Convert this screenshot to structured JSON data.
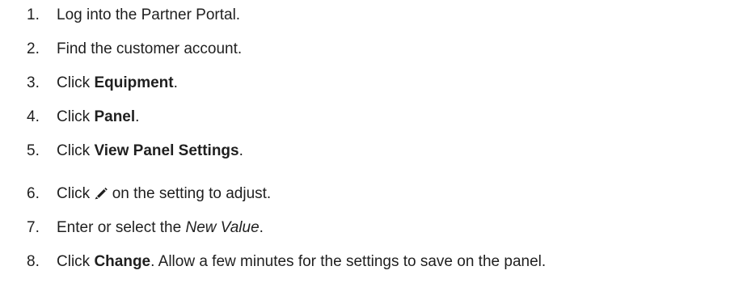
{
  "steps": [
    {
      "number": "1.",
      "text": "Log into the Partner Portal."
    },
    {
      "number": "2.",
      "text": "Find the customer account."
    },
    {
      "number": "3.",
      "pre": "Click ",
      "bold": "Equipment",
      "post": "."
    },
    {
      "number": "4.",
      "pre": "Click ",
      "bold": "Panel",
      "post": "."
    },
    {
      "number": "5.",
      "pre": "Click ",
      "bold": "View Panel Settings",
      "post": "."
    },
    {
      "number": "6.",
      "pre": "Click ",
      "icon": "pencil-edit-icon",
      "post": " on the setting to adjust."
    },
    {
      "number": "7.",
      "pre": "Enter or select the ",
      "italic": "New Value",
      "post": "."
    },
    {
      "number": "8.",
      "pre": "Click ",
      "bold": "Change",
      "post": ". Allow a few minutes for the settings to save on the panel."
    }
  ]
}
